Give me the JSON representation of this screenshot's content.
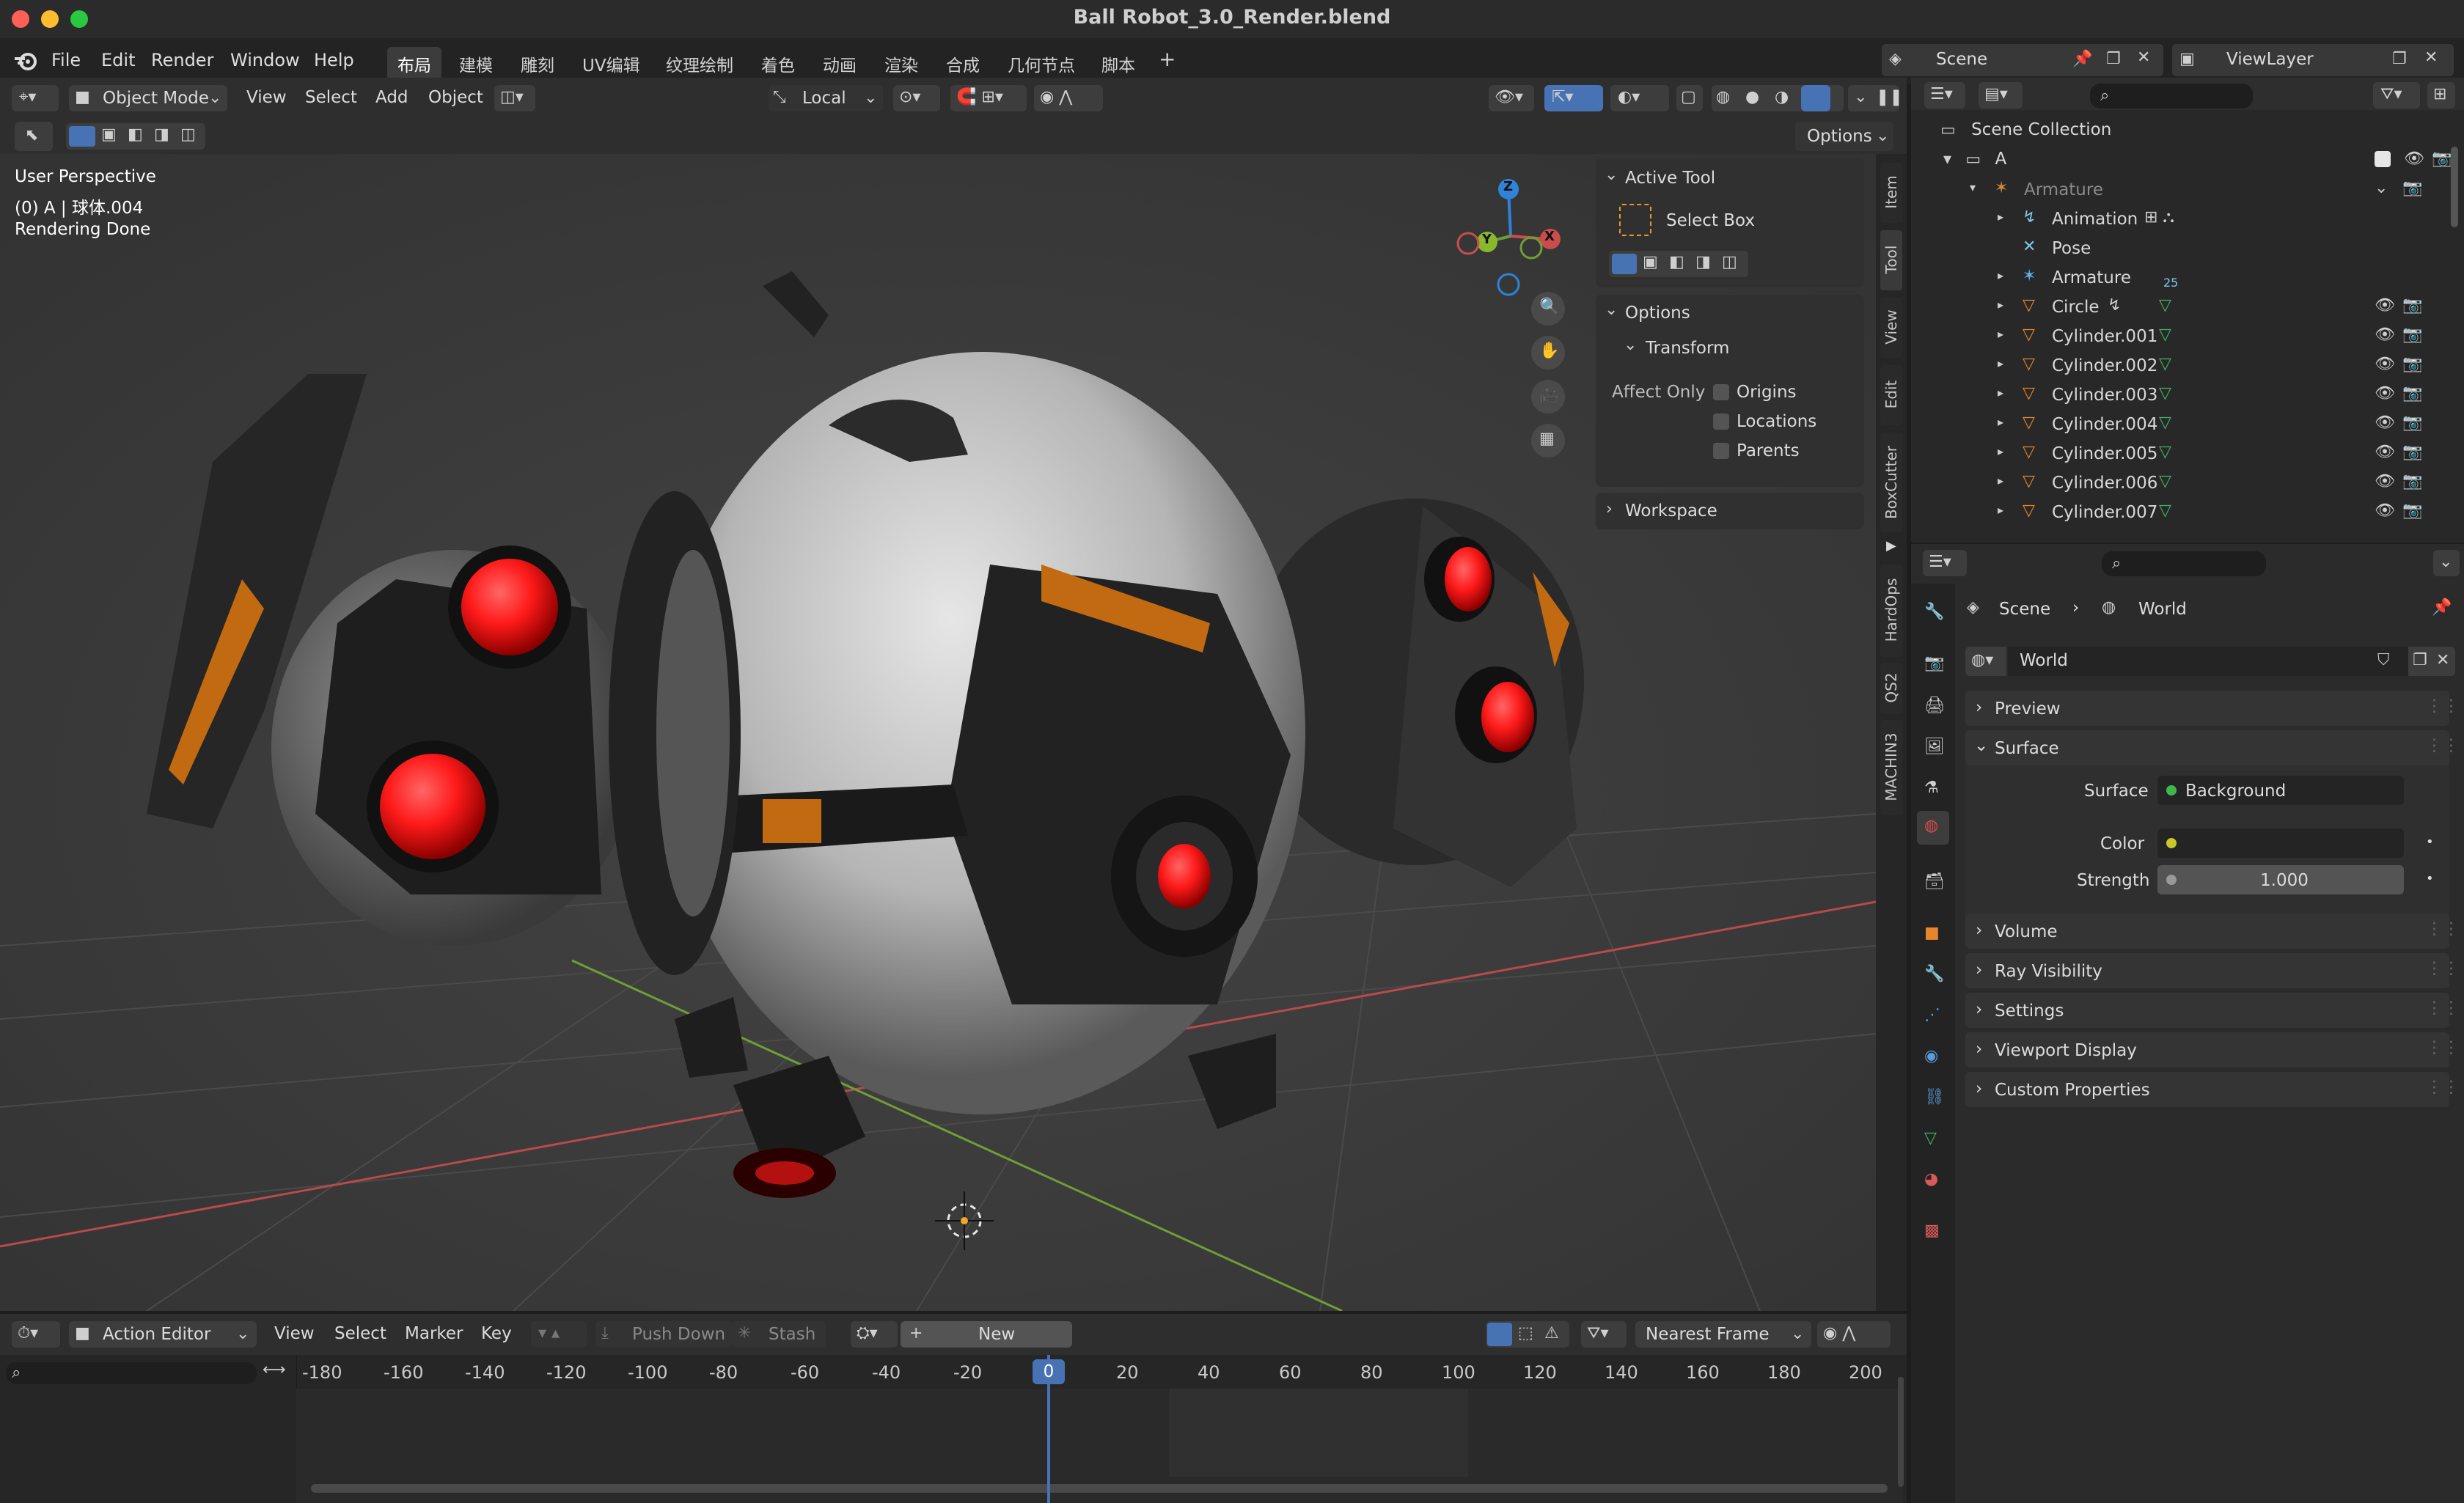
{
  "window": {
    "title": "Ball Robot_3.0_Render.blend"
  },
  "menubar": {
    "items": [
      "File",
      "Edit",
      "Render",
      "Window",
      "Help"
    ],
    "workspaces": [
      "布局",
      "建模",
      "雕刻",
      "UV编辑",
      "纹理绘制",
      "着色",
      "动画",
      "渲染",
      "合成",
      "几何节点",
      "脚本"
    ],
    "plus": "+",
    "scene_label": "Scene",
    "viewlayer_label": "ViewLayer"
  },
  "viewport_header": {
    "mode": "Object Mode",
    "menus": [
      "View",
      "Select",
      "Add",
      "Object"
    ],
    "transform_orientation": "Local",
    "options_label": "Options"
  },
  "viewport": {
    "overlay_lines": [
      "User Perspective",
      "(0) A | 球体.004",
      "Rendering Done"
    ],
    "gizmo": {
      "z": "Z",
      "y": "Y",
      "x": "X"
    }
  },
  "npanel": {
    "active_tool_title": "Active Tool",
    "active_tool_name": "Select Box",
    "options_title": "Options",
    "transform_title": "Transform",
    "affect_only_label": "Affect Only",
    "checkboxes": [
      "Origins",
      "Locations",
      "Parents"
    ],
    "workspace_title": "Workspace",
    "tabs": [
      "Item",
      "Tool",
      "View",
      "Edit",
      "BoxCutter",
      "HardOps",
      "QS2",
      "MACHIN3"
    ]
  },
  "outliner": {
    "root": "Scene Collection",
    "collection": "A",
    "rows": [
      {
        "label": "Armature",
        "dim": true
      },
      {
        "label": "Animation"
      },
      {
        "label": "Pose"
      },
      {
        "label": "Armature",
        "badge": "25"
      },
      {
        "label": "Circle"
      },
      {
        "label": "Cylinder.001"
      },
      {
        "label": "Cylinder.002"
      },
      {
        "label": "Cylinder.003"
      },
      {
        "label": "Cylinder.004"
      },
      {
        "label": "Cylinder.005"
      },
      {
        "label": "Cylinder.006"
      },
      {
        "label": "Cylinder.007"
      }
    ]
  },
  "properties": {
    "breadcrumb": [
      "Scene",
      "World"
    ],
    "world_name": "World",
    "sections": [
      "Preview",
      "Surface",
      "Volume",
      "Ray Visibility",
      "Settings",
      "Viewport Display",
      "Custom Properties"
    ],
    "surface_label": "Surface",
    "surface_value": "Background",
    "color_label": "Color",
    "strength_label": "Strength",
    "strength_value": "1.000"
  },
  "timeline": {
    "editor": "Action Editor",
    "menus": [
      "View",
      "Select",
      "Marker",
      "Key"
    ],
    "push_down": "Push Down",
    "stash": "Stash",
    "new_label": "New",
    "snap": "Nearest Frame",
    "ticks": [
      "-180",
      "-160",
      "-140",
      "-120",
      "-100",
      "-80",
      "-60",
      "-40",
      "-20",
      "0",
      "20",
      "40",
      "60",
      "80",
      "100",
      "120",
      "140",
      "160",
      "180",
      "200"
    ],
    "current_frame": "0"
  },
  "colors": {
    "accent": "#4772b3",
    "red_light": "#ff2a2a",
    "x_axis": "#c94d4d",
    "y_axis": "#6e9e36",
    "z_axis": "#2f83d9"
  }
}
